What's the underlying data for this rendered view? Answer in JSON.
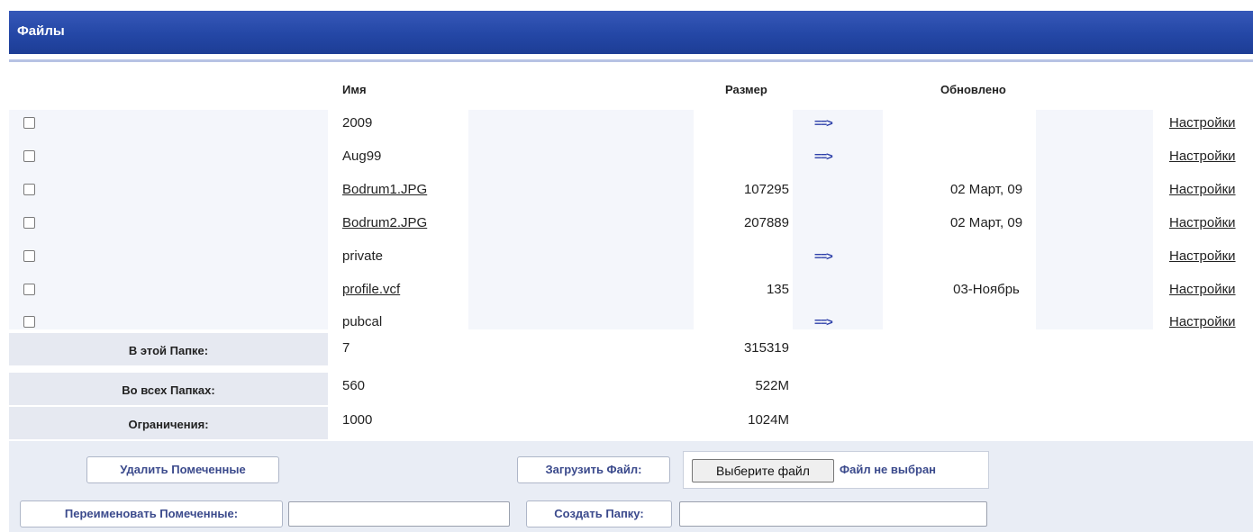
{
  "panel_title": "Файлы",
  "columns": {
    "name": "Имя",
    "size": "Размер",
    "updated": "Обновлено"
  },
  "files": [
    {
      "name": "2009",
      "size": "",
      "arrow": "==>",
      "date": "",
      "settings": "Настройки",
      "is_link": false
    },
    {
      "name": "Aug99",
      "size": "",
      "arrow": "==>",
      "date": "",
      "settings": "Настройки",
      "is_link": false
    },
    {
      "name": "Bodrum1.JPG",
      "size": "107295",
      "arrow": "",
      "date": "02 Март, 09",
      "settings": "Настройки",
      "is_link": true
    },
    {
      "name": "Bodrum2.JPG",
      "size": "207889",
      "arrow": "",
      "date": "02 Март, 09",
      "settings": "Настройки",
      "is_link": true
    },
    {
      "name": "private",
      "size": "",
      "arrow": "==>",
      "date": "",
      "settings": "Настройки",
      "is_link": false
    },
    {
      "name": "profile.vcf",
      "size": "135",
      "arrow": "",
      "date": "03-Ноябрь",
      "settings": "Настройки",
      "is_link": true
    },
    {
      "name": "pubcal",
      "size": "",
      "arrow": "==>",
      "date": "",
      "settings": "Настройки",
      "is_link": false
    }
  ],
  "summary": [
    {
      "label": "В этой Папке:",
      "count": "7",
      "size": "315319"
    },
    {
      "label": "Во всех Папках:",
      "count": "560",
      "size": "522M"
    },
    {
      "label": "Ограничения:",
      "count": "1000",
      "size": "1024M"
    }
  ],
  "actions": {
    "delete_marked": "Удалить Помеченные",
    "upload_file": "Загрузить Файл:",
    "choose_file": "Выберите файл",
    "no_file_chosen": "Файл не выбран",
    "rename_marked": "Переименовать Помеченные:",
    "rename_value": "",
    "create_folder": "Создать Папку:",
    "create_folder_value": ""
  }
}
